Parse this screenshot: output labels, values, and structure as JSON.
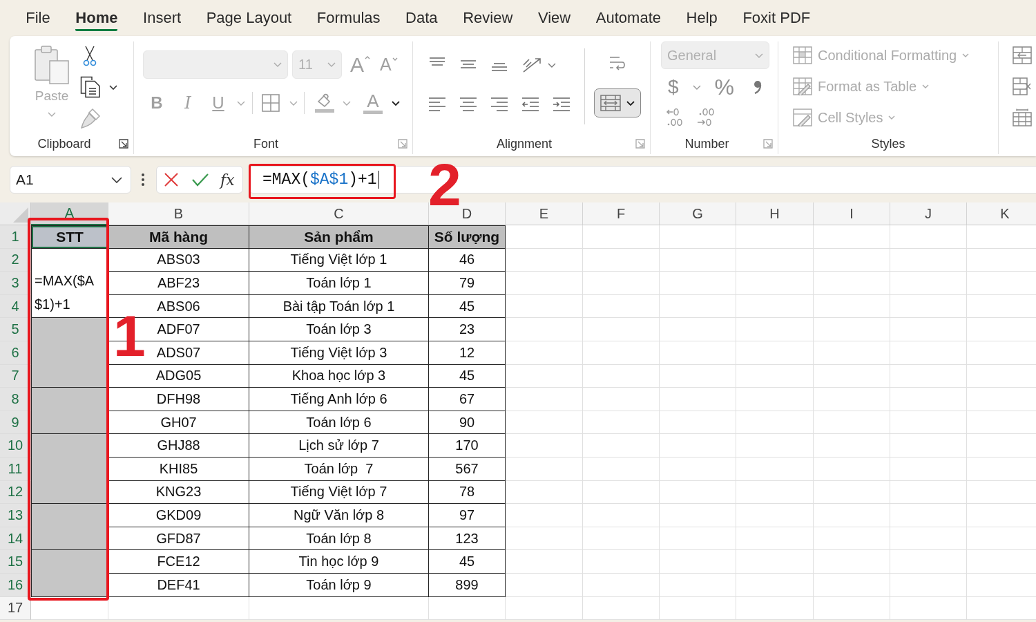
{
  "menu_tabs": [
    {
      "label": "File",
      "selected": false
    },
    {
      "label": "Home",
      "selected": true
    },
    {
      "label": "Insert",
      "selected": false
    },
    {
      "label": "Page Layout",
      "selected": false
    },
    {
      "label": "Formulas",
      "selected": false
    },
    {
      "label": "Data",
      "selected": false
    },
    {
      "label": "Review",
      "selected": false
    },
    {
      "label": "View",
      "selected": false
    },
    {
      "label": "Automate",
      "selected": false
    },
    {
      "label": "Help",
      "selected": false
    },
    {
      "label": "Foxit PDF",
      "selected": false
    }
  ],
  "ribbon": {
    "groups": [
      {
        "kind": "clipboard",
        "label": "Clipboard",
        "launcher": true,
        "paste": {
          "label": "Paste",
          "disabled": true
        }
      },
      {
        "kind": "font",
        "label": "Font",
        "launcher": true,
        "font_name": {
          "disabled": true
        },
        "font_size": {
          "value": "11",
          "disabled": true
        },
        "grow": "A",
        "shrink": "A",
        "bold": "B",
        "italic": "I",
        "underline": "U",
        "font_color": "A"
      },
      {
        "kind": "alignment",
        "label": "Alignment",
        "launcher": true,
        "merge_pressed": true
      },
      {
        "kind": "number",
        "label": "Number",
        "launcher": true,
        "format": {
          "value": "General",
          "disabled": true
        },
        "currency": "$",
        "percent": "%"
      },
      {
        "kind": "styles",
        "label": "Styles",
        "items": [
          {
            "kind": "conditional",
            "label": "Conditional Formatting",
            "disabled": true
          },
          {
            "kind": "table",
            "label": "Format as Table",
            "disabled": true
          },
          {
            "kind": "cell_styles",
            "label": "Cell Styles",
            "disabled": true
          }
        ]
      },
      {
        "kind": "cells"
      }
    ]
  },
  "formula_bar": {
    "name_box": "A1",
    "function_label": "fx",
    "formula": [
      {
        "kind": "plain",
        "text": "=MAX("
      },
      {
        "kind": "reference",
        "text": "$A$1"
      },
      {
        "kind": "plain",
        "text": ")+1"
      }
    ]
  },
  "sheet": {
    "columns": [
      {
        "label": "A",
        "selected": true
      },
      {
        "label": "B",
        "selected": false
      },
      {
        "label": "C",
        "selected": false
      },
      {
        "label": "D",
        "selected": false
      },
      {
        "label": "E",
        "selected": false
      },
      {
        "label": "F",
        "selected": false
      },
      {
        "label": "G",
        "selected": false
      },
      {
        "label": "H",
        "selected": false
      },
      {
        "label": "I",
        "selected": false
      },
      {
        "label": "J",
        "selected": false
      },
      {
        "label": "K",
        "selected": false
      }
    ],
    "row_headers": [
      {
        "label": "1",
        "selected": true
      },
      {
        "label": "2",
        "selected": true
      },
      {
        "label": "3",
        "selected": true
      },
      {
        "label": "4",
        "selected": true
      },
      {
        "label": "5",
        "selected": true
      },
      {
        "label": "6",
        "selected": true
      },
      {
        "label": "7",
        "selected": true
      },
      {
        "label": "8",
        "selected": true
      },
      {
        "label": "9",
        "selected": true
      },
      {
        "label": "10",
        "selected": true
      },
      {
        "label": "11",
        "selected": true
      },
      {
        "label": "12",
        "selected": true
      },
      {
        "label": "13",
        "selected": true
      },
      {
        "label": "14",
        "selected": true
      },
      {
        "label": "15",
        "selected": true
      },
      {
        "label": "16",
        "selected": true
      },
      {
        "label": "17",
        "selected": false
      }
    ],
    "table": {
      "columns": [
        {
          "label": "STT",
          "active": true
        },
        {
          "label": "Mã hàng",
          "active": false
        },
        {
          "label": "Sản phẩm",
          "active": false
        },
        {
          "label": "Số lượng",
          "active": false
        }
      ],
      "rows": [
        {
          "highlighted": false,
          "cells": [
            "",
            "ABS03",
            "Tiếng Việt lớp 1",
            "46"
          ]
        },
        {
          "merged_with_above": true,
          "cells": [
            "=MAX($A$1)+1",
            "ABF23",
            "Toán lớp 1",
            "79"
          ]
        },
        {
          "merged_with_above": true,
          "cells": [
            "",
            "ABS06",
            "Bài tập Toán lớp 1",
            "45"
          ]
        },
        {
          "highlighted": true,
          "cells": [
            "",
            "ADF07",
            "Toán lớp 3",
            "23"
          ]
        },
        {
          "merged_with_above": true,
          "cells": [
            "",
            "ADS07",
            "Tiếng Việt lớp 3",
            "12"
          ]
        },
        {
          "merged_with_above": true,
          "cells": [
            "",
            "ADG05",
            "Khoa học lớp 3",
            "45"
          ]
        },
        {
          "highlighted": true,
          "cells": [
            "",
            "DFH98",
            "Tiếng Anh lớp 6",
            "67"
          ]
        },
        {
          "merged_with_above": true,
          "cells": [
            "",
            "GH07",
            "Toán lớp 6",
            "90"
          ]
        },
        {
          "highlighted": true,
          "cells": [
            "",
            "GHJ88",
            "Lịch sử lớp 7",
            "170"
          ]
        },
        {
          "merged_with_above": true,
          "cells": [
            "",
            "KHI85",
            "Toán lớp  7",
            "567"
          ]
        },
        {
          "merged_with_above": true,
          "cells": [
            "",
            "KNG23",
            "Tiếng Việt lớp 7",
            "78"
          ]
        },
        {
          "highlighted": true,
          "cells": [
            "",
            "GKD09",
            "Ngữ Văn lớp 8",
            "97"
          ]
        },
        {
          "merged_with_above": true,
          "cells": [
            "",
            "GFD87",
            "Toán lớp 8",
            "123"
          ]
        },
        {
          "highlighted": true,
          "cells": [
            "",
            "FCE12",
            "Tin học lớp 9",
            "45"
          ]
        },
        {
          "merged_with_above": true,
          "cells": [
            "",
            "DEF41",
            "Toán lớp 9",
            "899"
          ]
        }
      ]
    }
  },
  "annotations": [
    {
      "number": "1"
    },
    {
      "number": "2"
    }
  ]
}
